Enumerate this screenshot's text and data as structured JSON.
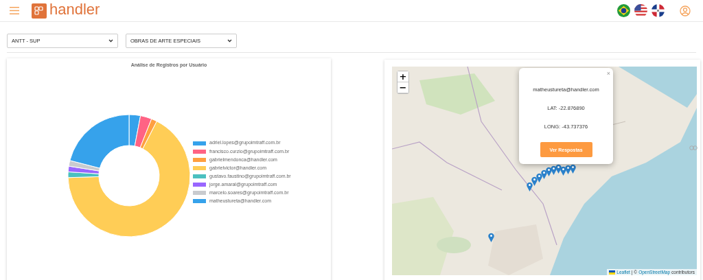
{
  "header": {
    "brand": "handler"
  },
  "filters": [
    {
      "value": "ANTT - SUP"
    },
    {
      "value": "OBRAS DE ARTE ESPECIAIS"
    }
  ],
  "chart": {
    "title": "Análise de Registros por Usuário",
    "legend": [
      {
        "label": "adriel.lopes@grupoimtraff.com.br",
        "color": "#36a2eb"
      },
      {
        "label": "francisco.curzio@grupoimtraff.com.br",
        "color": "#ff6384"
      },
      {
        "label": "gabrielmendonca@handler.com",
        "color": "#ff9f40"
      },
      {
        "label": "gabrielvictor@handler.com",
        "color": "#ffcd56"
      },
      {
        "label": "gustavo.faustino@grupoimtraff.com.br",
        "color": "#4bc0c0"
      },
      {
        "label": "jorge.amaral@grupoimtraff.com",
        "color": "#9966ff"
      },
      {
        "label": "marcelo.soares@grupoimtraff.com.br",
        "color": "#c9cbcf"
      },
      {
        "label": "matheustureta@handler.com",
        "color": "#36a2eb"
      }
    ]
  },
  "map": {
    "zoom_in": "+",
    "zoom_out": "−",
    "popup": {
      "close": "×",
      "email": "matheustureta@handler.com",
      "lat": "LAT: -22.876890",
      "long": "LONG: -43.737376",
      "button": "Ver Respostas"
    },
    "attribution": {
      "leaflet": "Leaflet",
      "separator": "| ©",
      "osm": "OpenStreetMap",
      "suffix": "contributors"
    }
  }
}
